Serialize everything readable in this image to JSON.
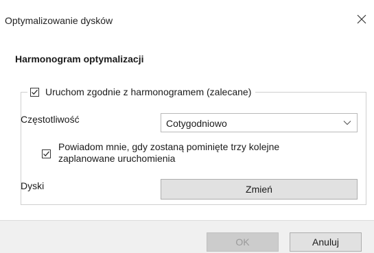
{
  "window": {
    "title": "Optymalizowanie dysków",
    "close_icon": "close-icon"
  },
  "schedule": {
    "heading": "Harmonogram optymalizacji",
    "run_on_schedule": {
      "label": "Uruchom zgodnie z harmonogramem (zalecane)",
      "checked": true
    },
    "frequency": {
      "label": "Częstotliwość",
      "selected": "Cotygodniowo",
      "icon": "chevron-down-icon"
    },
    "notify": {
      "label": "Powiadom mnie, gdy zostaną pominięte trzy kolejne zaplanowane uruchomienia",
      "checked": true
    },
    "disks": {
      "label": "Dyski",
      "button_label": "Zmień"
    }
  },
  "footer": {
    "ok_label": "OK",
    "ok_enabled": false,
    "cancel_label": "Anuluj"
  },
  "colors": {
    "footer_bg": "#f0f0f0",
    "button_bg": "#e1e1e1",
    "disabled_button_bg": "#cccccc"
  }
}
